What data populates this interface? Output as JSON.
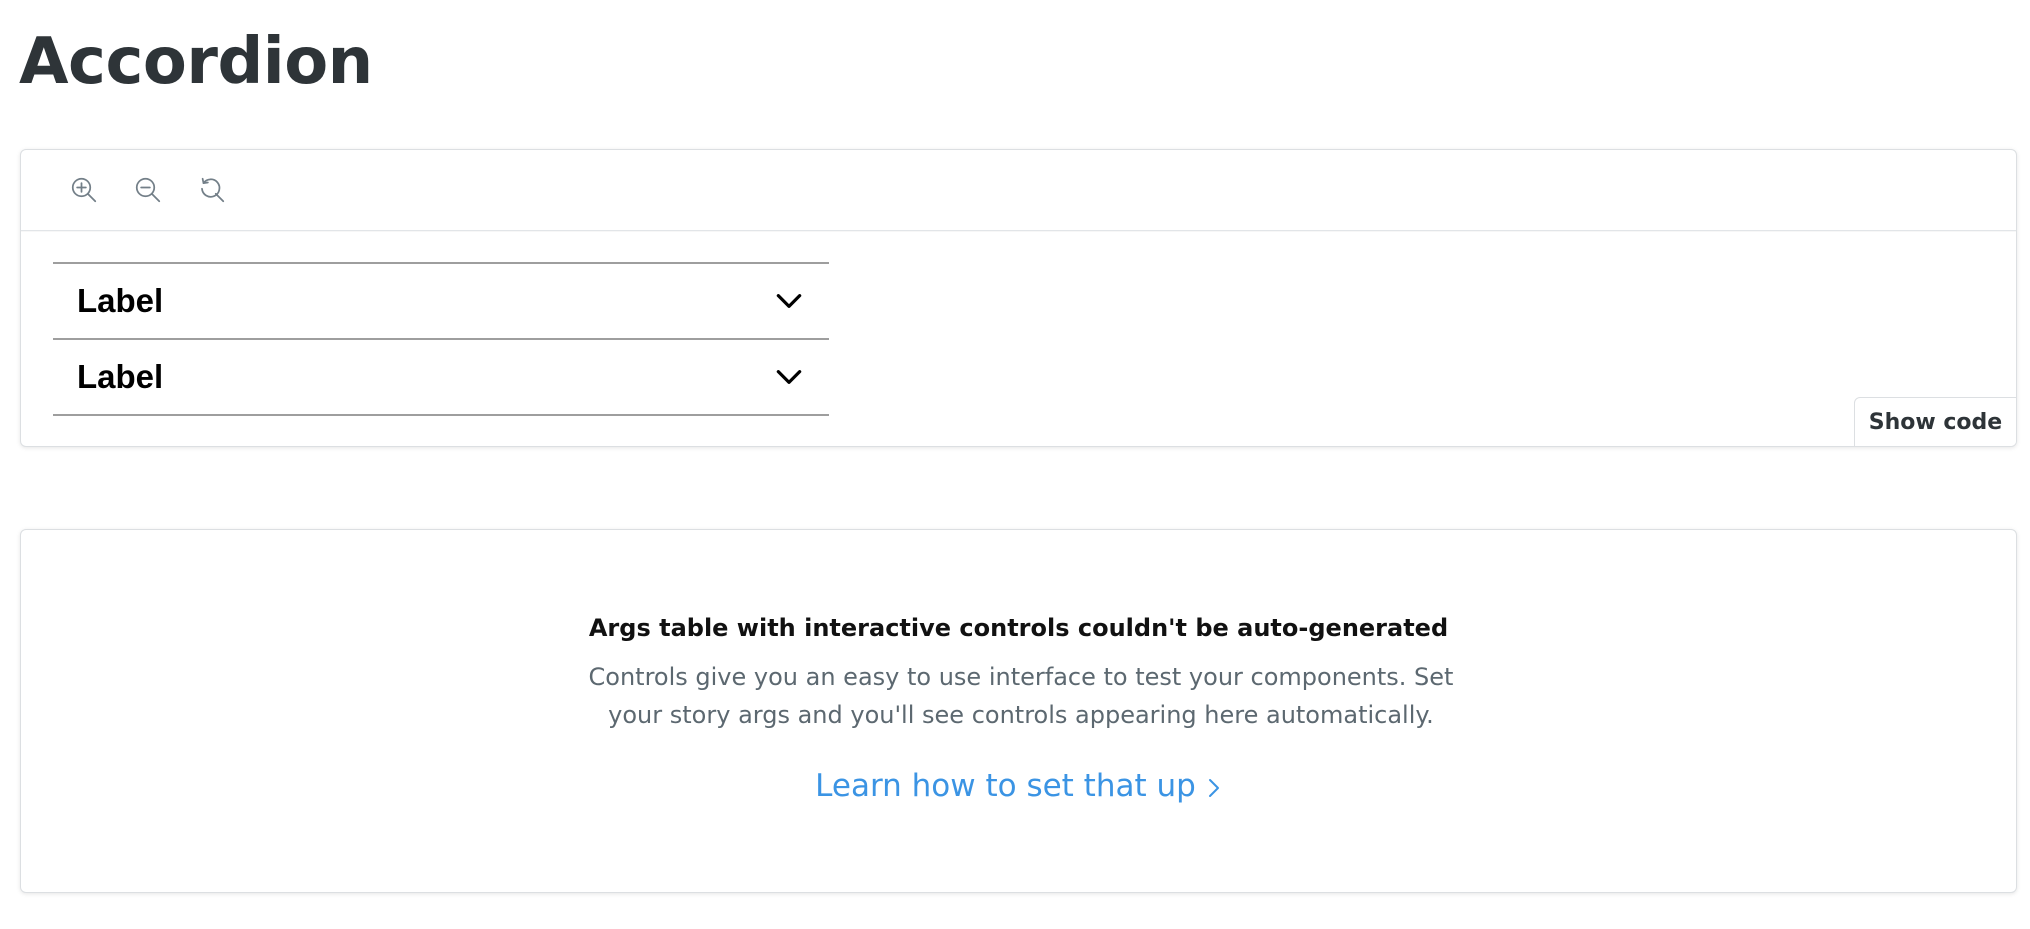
{
  "page": {
    "title": "Accordion"
  },
  "toolbar": {
    "tools": [
      {
        "icon": "zoom-in-icon"
      },
      {
        "icon": "zoom-out-icon"
      },
      {
        "icon": "reset-zoom-icon"
      }
    ]
  },
  "story": {
    "accordion_items": [
      {
        "label": "Label",
        "icon": "chevron-down-icon"
      },
      {
        "label": "Label",
        "icon": "chevron-down-icon"
      }
    ]
  },
  "preview": {
    "show_code_label": "Show code"
  },
  "args_table": {
    "title": "Args table with interactive controls couldn't be auto-generated",
    "description": "Controls give you an easy to use interface to test your components. Set your story args and you'll see controls appearing here automatically.",
    "link_label": "Learn how to set that up",
    "link_icon": "chevron-right-icon",
    "link_color": "#3b94e4"
  }
}
